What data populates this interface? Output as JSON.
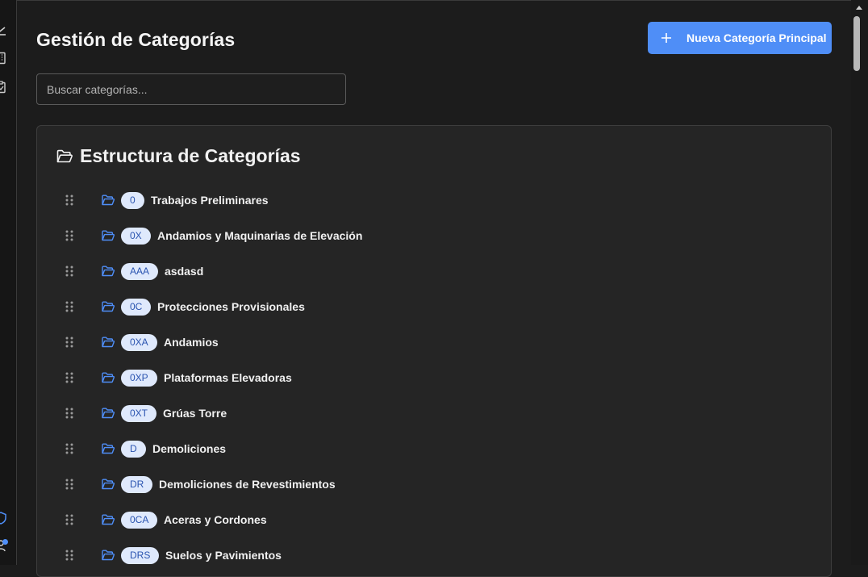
{
  "header": {
    "title": "Gestión de Categorías",
    "new_button_label": "Nueva Categoría Principal"
  },
  "search": {
    "placeholder": "Buscar categorías...",
    "value": ""
  },
  "structure": {
    "title": "Estructura de Categorías",
    "items": [
      {
        "code": "0",
        "name": "Trabajos Preliminares"
      },
      {
        "code": "0X",
        "name": "Andamios y Maquinarias de Elevación"
      },
      {
        "code": "AAA",
        "name": "asdasd"
      },
      {
        "code": "0C",
        "name": "Protecciones Provisionales"
      },
      {
        "code": "0XA",
        "name": "Andamios"
      },
      {
        "code": "0XP",
        "name": "Plataformas Elevadoras"
      },
      {
        "code": "0XT",
        "name": "Grúas Torre"
      },
      {
        "code": "D",
        "name": "Demoliciones"
      },
      {
        "code": "DR",
        "name": "Demoliciones de Revestimientos"
      },
      {
        "code": "0CA",
        "name": "Aceras y Cordones"
      },
      {
        "code": "DRS",
        "name": "Suelos y Pavimientos"
      }
    ]
  },
  "icons": {
    "new_button": "plus-icon",
    "structure_header": "folder-open-icon",
    "row_handle": "drag-handle-icon",
    "row_folder": "folder-icon"
  },
  "colors": {
    "accent": "#4f8ef7",
    "badge_bg": "#dfe9fc",
    "badge_text": "#2a54b0",
    "background": "#1c1c1c",
    "card_bg": "#252525"
  }
}
